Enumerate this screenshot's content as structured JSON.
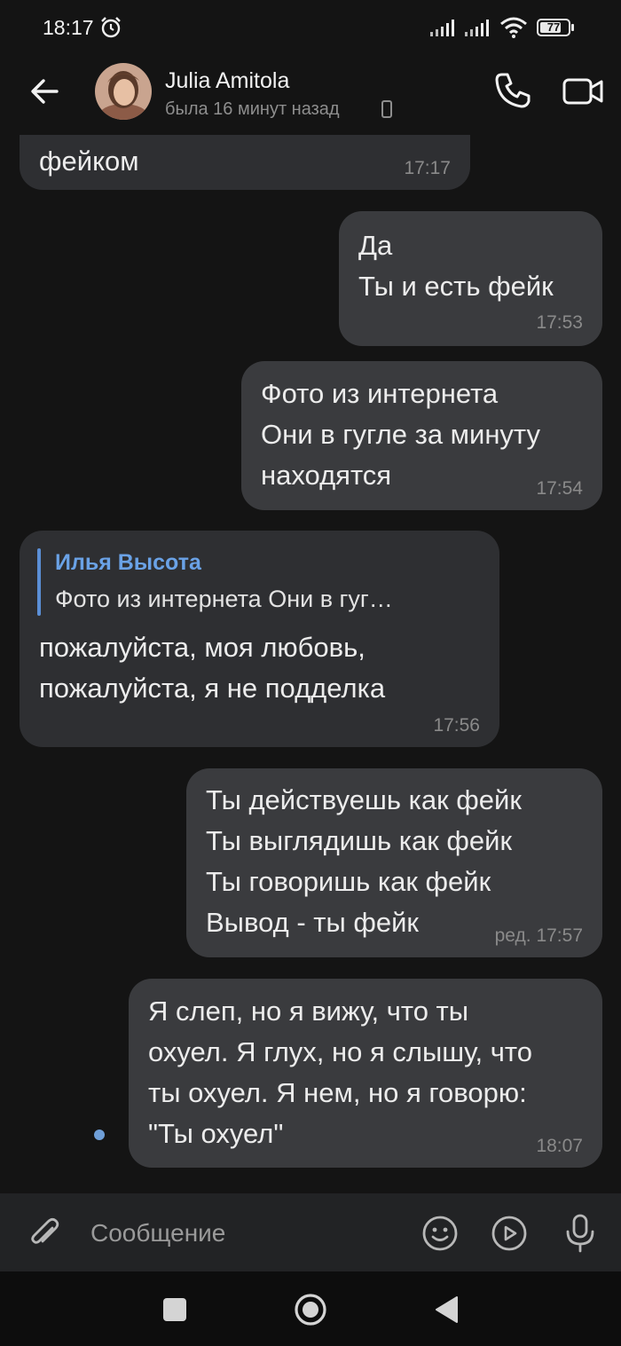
{
  "status_bar": {
    "time": "18:17",
    "battery": "77",
    "battery_level": 0.77
  },
  "header": {
    "contact_name": "Julia Amitola",
    "contact_status": "была 16 минут назад"
  },
  "messages": [
    {
      "direction": "in",
      "text": "фейком",
      "time": "17:17"
    },
    {
      "direction": "out",
      "text": "Да\nТы и есть фейк",
      "time": "17:53"
    },
    {
      "direction": "out",
      "text": "Фото из интернета\nОни в гугле за минуту\nнаходятся",
      "time": "17:54"
    },
    {
      "direction": "in",
      "reply": {
        "author": "Илья Высота",
        "text": "Фото из интернета  Они в гуг…"
      },
      "text": "пожалуйста, моя любовь,\nпожалуйста, я не подделка",
      "time": "17:56"
    },
    {
      "direction": "out",
      "text": "Ты действуешь как фейк\nТы выглядишь как фейк\nТы говоришь как фейк\nВывод - ты фейк",
      "time": "ред. 17:57"
    },
    {
      "direction": "out",
      "text": "Я слеп, но я вижу, что ты\nохуел. Я глух, но я слышу, что\nты охуел. Я нем, но я говорю:\n\"Ты охуел\"",
      "time": "18:07",
      "unread": true
    }
  ],
  "composer": {
    "placeholder": "Сообщение"
  },
  "icons": {
    "back": "arrow-left-icon",
    "call": "phone-icon",
    "video": "video-camera-icon",
    "attach": "paperclip-icon",
    "emoji": "smiley-icon",
    "video_message": "play-circle-icon",
    "voice": "microphone-icon"
  },
  "colors": {
    "background": "#141414",
    "bubble_in": "#2e2f32",
    "bubble_out": "#3a3b3e",
    "reply_accent": "#6aa2e6"
  }
}
